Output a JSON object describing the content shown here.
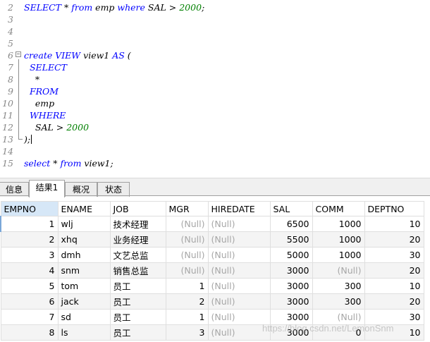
{
  "editor": {
    "lines": [
      {
        "n": "2",
        "parts": [
          [
            "kw",
            "SELECT"
          ],
          [
            "t",
            " * "
          ],
          [
            "kw",
            "from"
          ],
          [
            "t",
            " emp "
          ],
          [
            "kw",
            "where"
          ],
          [
            "t",
            " SAL > "
          ],
          [
            "num",
            "2000"
          ],
          [
            "t",
            ";"
          ]
        ]
      },
      {
        "n": "3",
        "parts": []
      },
      {
        "n": "4",
        "parts": []
      },
      {
        "n": "5",
        "parts": []
      },
      {
        "n": "6",
        "parts": [
          [
            "kw",
            "create VIEW"
          ],
          [
            "t",
            " view1 "
          ],
          [
            "kw",
            "AS"
          ],
          [
            "t",
            " ("
          ]
        ]
      },
      {
        "n": "7",
        "parts": [
          [
            "t",
            "  "
          ],
          [
            "kw",
            "SELECT"
          ]
        ]
      },
      {
        "n": "8",
        "parts": [
          [
            "t",
            "    *"
          ]
        ]
      },
      {
        "n": "9",
        "parts": [
          [
            "t",
            "  "
          ],
          [
            "kw",
            "FROM"
          ]
        ]
      },
      {
        "n": "10",
        "parts": [
          [
            "t",
            "    emp"
          ]
        ]
      },
      {
        "n": "11",
        "parts": [
          [
            "t",
            "  "
          ],
          [
            "kw",
            "WHERE"
          ]
        ]
      },
      {
        "n": "12",
        "parts": [
          [
            "t",
            "    SAL > "
          ],
          [
            "num",
            "2000"
          ]
        ]
      },
      {
        "n": "13",
        "parts": [
          [
            "t",
            ");"
          ]
        ]
      },
      {
        "n": "14",
        "parts": []
      },
      {
        "n": "15",
        "parts": [
          [
            "kw",
            "select"
          ],
          [
            "t",
            " * "
          ],
          [
            "kw",
            "from"
          ],
          [
            "t",
            " view1;"
          ]
        ]
      }
    ]
  },
  "tabs": [
    {
      "label": "信息",
      "active": false
    },
    {
      "label": "结果1",
      "active": true
    },
    {
      "label": "概况",
      "active": false
    },
    {
      "label": "状态",
      "active": false
    }
  ],
  "grid": {
    "columns": [
      "EMPNO",
      "ENAME",
      "JOB",
      "MGR",
      "HIREDATE",
      "SAL",
      "COMM",
      "DEPTNO"
    ],
    "rows": [
      [
        "1",
        "wlj",
        "技术经理",
        "(Null)",
        "(Null)",
        "6500",
        "1000",
        "10"
      ],
      [
        "2",
        "xhq",
        "业务经理",
        "(Null)",
        "(Null)",
        "5500",
        "1000",
        "20"
      ],
      [
        "3",
        "dmh",
        "文艺总监",
        "(Null)",
        "(Null)",
        "5000",
        "1000",
        "30"
      ],
      [
        "4",
        "snm",
        "销售总监",
        "(Null)",
        "(Null)",
        "3000",
        "(Null)",
        "20"
      ],
      [
        "5",
        "tom",
        "员工",
        "1",
        "(Null)",
        "3000",
        "300",
        "10"
      ],
      [
        "6",
        "jack",
        "员工",
        "2",
        "(Null)",
        "3000",
        "300",
        "20"
      ],
      [
        "7",
        "sd",
        "员工",
        "1",
        "(Null)",
        "3000",
        "(Null)",
        "30"
      ],
      [
        "8",
        "ls",
        "员工",
        "3",
        "(Null)",
        "3000",
        "0",
        "10"
      ]
    ]
  },
  "watermark": "https://blog.csdn.net/LemonSnm"
}
